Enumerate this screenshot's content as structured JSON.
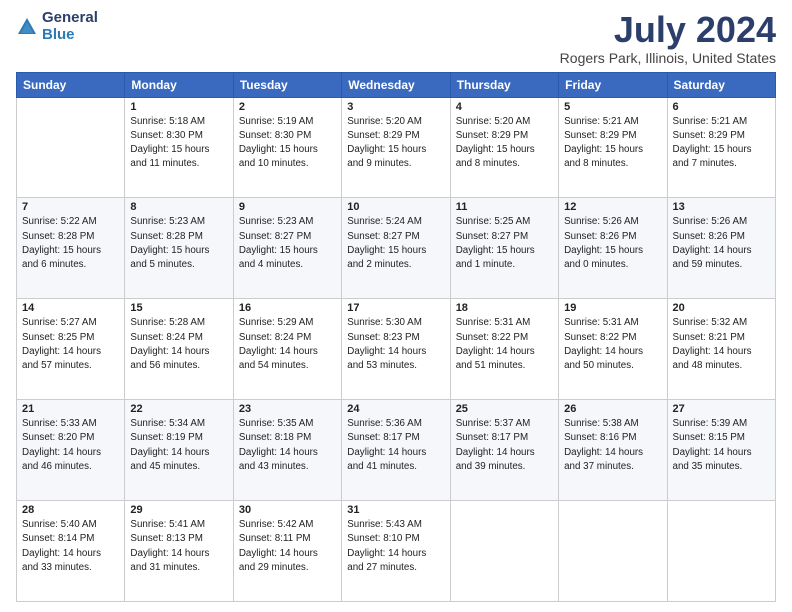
{
  "logo": {
    "general": "General",
    "blue": "Blue"
  },
  "title": "July 2024",
  "location": "Rogers Park, Illinois, United States",
  "days_of_week": [
    "Sunday",
    "Monday",
    "Tuesday",
    "Wednesday",
    "Thursday",
    "Friday",
    "Saturday"
  ],
  "weeks": [
    [
      {
        "day": "",
        "sunrise": "",
        "sunset": "",
        "daylight": ""
      },
      {
        "day": "1",
        "sunrise": "Sunrise: 5:18 AM",
        "sunset": "Sunset: 8:30 PM",
        "daylight": "Daylight: 15 hours and 11 minutes."
      },
      {
        "day": "2",
        "sunrise": "Sunrise: 5:19 AM",
        "sunset": "Sunset: 8:30 PM",
        "daylight": "Daylight: 15 hours and 10 minutes."
      },
      {
        "day": "3",
        "sunrise": "Sunrise: 5:20 AM",
        "sunset": "Sunset: 8:29 PM",
        "daylight": "Daylight: 15 hours and 9 minutes."
      },
      {
        "day": "4",
        "sunrise": "Sunrise: 5:20 AM",
        "sunset": "Sunset: 8:29 PM",
        "daylight": "Daylight: 15 hours and 8 minutes."
      },
      {
        "day": "5",
        "sunrise": "Sunrise: 5:21 AM",
        "sunset": "Sunset: 8:29 PM",
        "daylight": "Daylight: 15 hours and 8 minutes."
      },
      {
        "day": "6",
        "sunrise": "Sunrise: 5:21 AM",
        "sunset": "Sunset: 8:29 PM",
        "daylight": "Daylight: 15 hours and 7 minutes."
      }
    ],
    [
      {
        "day": "7",
        "sunrise": "Sunrise: 5:22 AM",
        "sunset": "Sunset: 8:28 PM",
        "daylight": "Daylight: 15 hours and 6 minutes."
      },
      {
        "day": "8",
        "sunrise": "Sunrise: 5:23 AM",
        "sunset": "Sunset: 8:28 PM",
        "daylight": "Daylight: 15 hours and 5 minutes."
      },
      {
        "day": "9",
        "sunrise": "Sunrise: 5:23 AM",
        "sunset": "Sunset: 8:27 PM",
        "daylight": "Daylight: 15 hours and 4 minutes."
      },
      {
        "day": "10",
        "sunrise": "Sunrise: 5:24 AM",
        "sunset": "Sunset: 8:27 PM",
        "daylight": "Daylight: 15 hours and 2 minutes."
      },
      {
        "day": "11",
        "sunrise": "Sunrise: 5:25 AM",
        "sunset": "Sunset: 8:27 PM",
        "daylight": "Daylight: 15 hours and 1 minute."
      },
      {
        "day": "12",
        "sunrise": "Sunrise: 5:26 AM",
        "sunset": "Sunset: 8:26 PM",
        "daylight": "Daylight: 15 hours and 0 minutes."
      },
      {
        "day": "13",
        "sunrise": "Sunrise: 5:26 AM",
        "sunset": "Sunset: 8:26 PM",
        "daylight": "Daylight: 14 hours and 59 minutes."
      }
    ],
    [
      {
        "day": "14",
        "sunrise": "Sunrise: 5:27 AM",
        "sunset": "Sunset: 8:25 PM",
        "daylight": "Daylight: 14 hours and 57 minutes."
      },
      {
        "day": "15",
        "sunrise": "Sunrise: 5:28 AM",
        "sunset": "Sunset: 8:24 PM",
        "daylight": "Daylight: 14 hours and 56 minutes."
      },
      {
        "day": "16",
        "sunrise": "Sunrise: 5:29 AM",
        "sunset": "Sunset: 8:24 PM",
        "daylight": "Daylight: 14 hours and 54 minutes."
      },
      {
        "day": "17",
        "sunrise": "Sunrise: 5:30 AM",
        "sunset": "Sunset: 8:23 PM",
        "daylight": "Daylight: 14 hours and 53 minutes."
      },
      {
        "day": "18",
        "sunrise": "Sunrise: 5:31 AM",
        "sunset": "Sunset: 8:22 PM",
        "daylight": "Daylight: 14 hours and 51 minutes."
      },
      {
        "day": "19",
        "sunrise": "Sunrise: 5:31 AM",
        "sunset": "Sunset: 8:22 PM",
        "daylight": "Daylight: 14 hours and 50 minutes."
      },
      {
        "day": "20",
        "sunrise": "Sunrise: 5:32 AM",
        "sunset": "Sunset: 8:21 PM",
        "daylight": "Daylight: 14 hours and 48 minutes."
      }
    ],
    [
      {
        "day": "21",
        "sunrise": "Sunrise: 5:33 AM",
        "sunset": "Sunset: 8:20 PM",
        "daylight": "Daylight: 14 hours and 46 minutes."
      },
      {
        "day": "22",
        "sunrise": "Sunrise: 5:34 AM",
        "sunset": "Sunset: 8:19 PM",
        "daylight": "Daylight: 14 hours and 45 minutes."
      },
      {
        "day": "23",
        "sunrise": "Sunrise: 5:35 AM",
        "sunset": "Sunset: 8:18 PM",
        "daylight": "Daylight: 14 hours and 43 minutes."
      },
      {
        "day": "24",
        "sunrise": "Sunrise: 5:36 AM",
        "sunset": "Sunset: 8:17 PM",
        "daylight": "Daylight: 14 hours and 41 minutes."
      },
      {
        "day": "25",
        "sunrise": "Sunrise: 5:37 AM",
        "sunset": "Sunset: 8:17 PM",
        "daylight": "Daylight: 14 hours and 39 minutes."
      },
      {
        "day": "26",
        "sunrise": "Sunrise: 5:38 AM",
        "sunset": "Sunset: 8:16 PM",
        "daylight": "Daylight: 14 hours and 37 minutes."
      },
      {
        "day": "27",
        "sunrise": "Sunrise: 5:39 AM",
        "sunset": "Sunset: 8:15 PM",
        "daylight": "Daylight: 14 hours and 35 minutes."
      }
    ],
    [
      {
        "day": "28",
        "sunrise": "Sunrise: 5:40 AM",
        "sunset": "Sunset: 8:14 PM",
        "daylight": "Daylight: 14 hours and 33 minutes."
      },
      {
        "day": "29",
        "sunrise": "Sunrise: 5:41 AM",
        "sunset": "Sunset: 8:13 PM",
        "daylight": "Daylight: 14 hours and 31 minutes."
      },
      {
        "day": "30",
        "sunrise": "Sunrise: 5:42 AM",
        "sunset": "Sunset: 8:11 PM",
        "daylight": "Daylight: 14 hours and 29 minutes."
      },
      {
        "day": "31",
        "sunrise": "Sunrise: 5:43 AM",
        "sunset": "Sunset: 8:10 PM",
        "daylight": "Daylight: 14 hours and 27 minutes."
      },
      {
        "day": "",
        "sunrise": "",
        "sunset": "",
        "daylight": ""
      },
      {
        "day": "",
        "sunrise": "",
        "sunset": "",
        "daylight": ""
      },
      {
        "day": "",
        "sunrise": "",
        "sunset": "",
        "daylight": ""
      }
    ]
  ]
}
